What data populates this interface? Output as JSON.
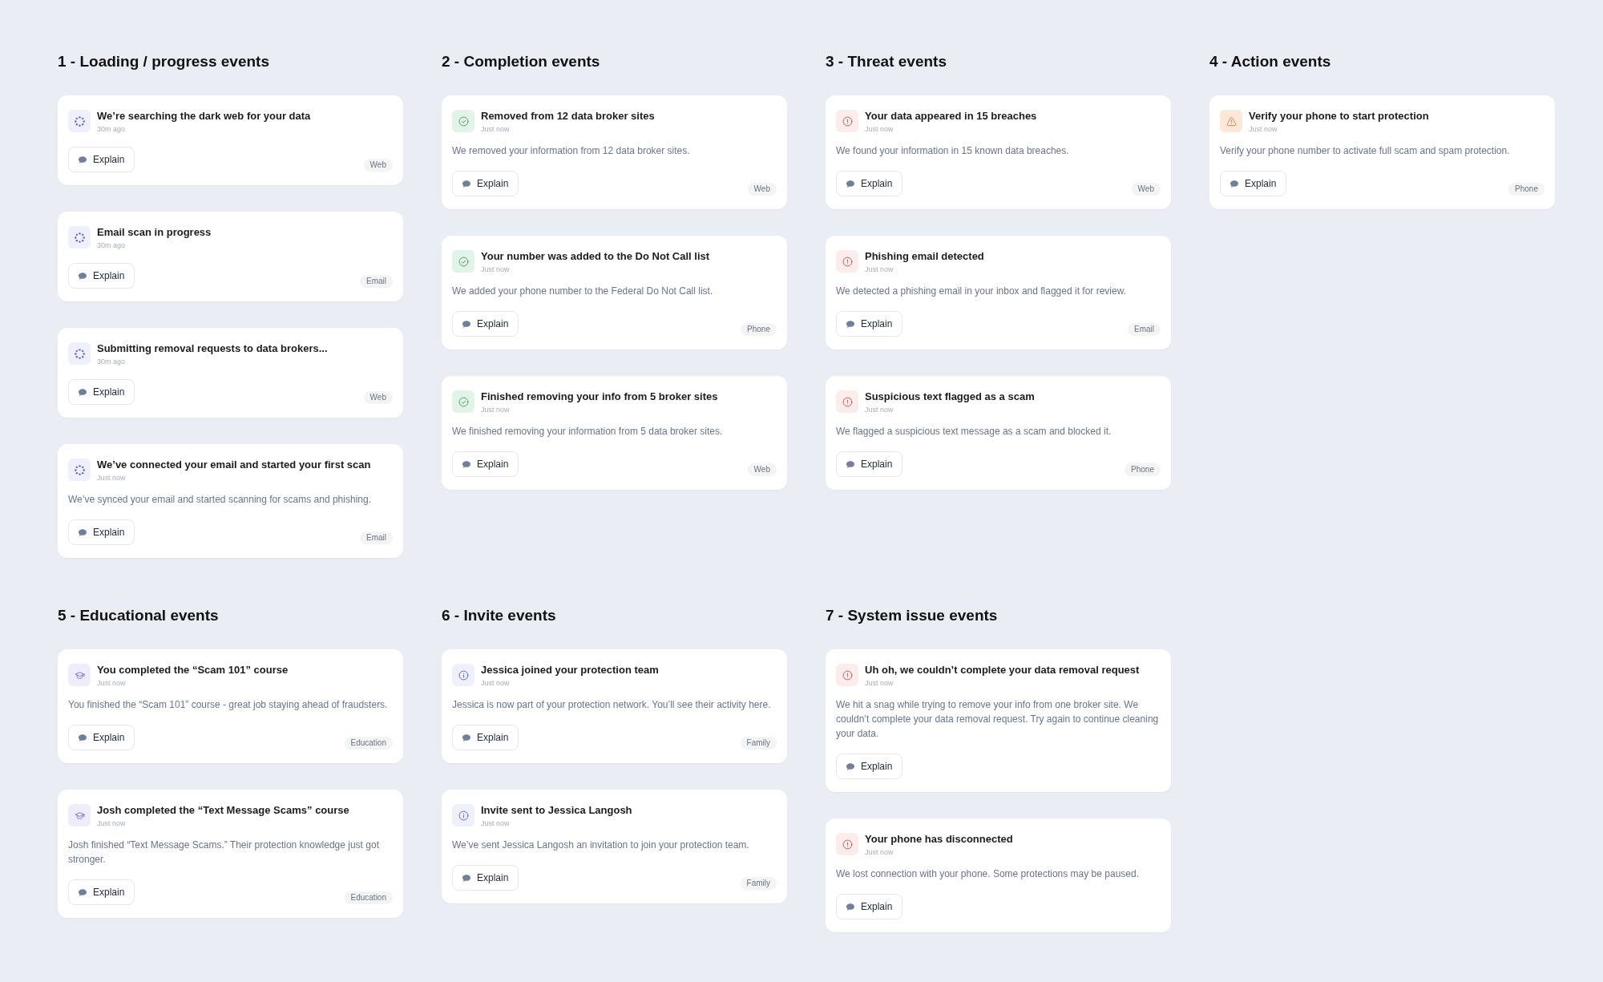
{
  "sections": [
    {
      "title": "1 - Loading / progress events",
      "kind": "loading",
      "events": [
        {
          "title": "We’re searching the dark web for your data",
          "time": "30m ago",
          "button": "Explain",
          "tag": "Web"
        },
        {
          "title": "Email scan in progress",
          "time": "30m ago",
          "button": "Explain",
          "tag": "Email"
        },
        {
          "title": "Submitting removal requests to data brokers...",
          "time": "30m ago",
          "button": "Explain",
          "tag": "Web"
        },
        {
          "title": "We’ve connected your email and started your first scan",
          "time": "Just now",
          "description": "We’ve synced your email and started scanning for scams and phishing.",
          "button": "Explain",
          "tag": "Email"
        }
      ]
    },
    {
      "title": "2 - Completion events",
      "kind": "success",
      "events": [
        {
          "title": "Removed from 12 data broker sites",
          "time": "Just now",
          "description": "We removed your information from 12 data broker sites.",
          "button": "Explain",
          "tag": "Web"
        },
        {
          "title": "Your number was added to the Do Not Call list",
          "time": "Just now",
          "description": "We added your phone number to the Federal Do Not Call list.",
          "button": "Explain",
          "tag": "Phone"
        },
        {
          "title": "Finished removing your info from 5 broker sites",
          "time": "Just now",
          "description": "We finished removing your information from 5 data broker sites.",
          "button": "Explain",
          "tag": "Web"
        }
      ]
    },
    {
      "title": "3 - Threat events",
      "kind": "alert",
      "events": [
        {
          "title": "Your data appeared in 15 breaches",
          "time": "Just now",
          "description": "We found your information in 15 known data breaches.",
          "button": "Explain",
          "tag": "Web"
        },
        {
          "title": "Phishing email detected",
          "time": "Just now",
          "description": "We detected a phishing email in your inbox and flagged it for review.",
          "button": "Explain",
          "tag": "Email"
        },
        {
          "title": "Suspicious text flagged as a scam",
          "time": "Just now",
          "description": "We flagged a suspicious text message as a scam and blocked it.",
          "button": "Explain",
          "tag": "Phone"
        }
      ]
    },
    {
      "title": "4 - Action events",
      "kind": "action",
      "events": [
        {
          "title": "Verify your phone to start protection",
          "time": "Just now",
          "description": "Verify your phone number to activate full scam and spam protection.",
          "button": "Explain",
          "tag": "Phone"
        }
      ]
    },
    {
      "title": "5 - Educational events",
      "kind": "education",
      "events": [
        {
          "title": "You completed the “Scam 101” course",
          "time": "Just now",
          "description": "You finished the “Scam 101” course - great job staying ahead of fraudsters.",
          "button": "Explain",
          "tag": "Education"
        },
        {
          "title": "Josh completed the “Text Message Scams” course",
          "time": "Just now",
          "description": "Josh finished “Text Message Scams.” Their protection knowledge just got stronger.",
          "button": "Explain",
          "tag": "Education"
        }
      ]
    },
    {
      "title": "6 - Invite events",
      "kind": "info",
      "events": [
        {
          "title": "Jessica joined your protection team",
          "time": "Just now",
          "description": "Jessica is now part of your protection network. You’ll see their activity here.",
          "button": "Explain",
          "tag": "Family"
        },
        {
          "title": "Invite sent to Jessica Langosh",
          "time": "Just now",
          "description": "We’ve sent Jessica Langosh an invitation to join your protection team.",
          "button": "Explain",
          "tag": "Family"
        }
      ]
    },
    {
      "title": "7 - System issue events",
      "kind": "alert",
      "events": [
        {
          "title": "Uh oh, we couldn’t complete your data removal request",
          "time": "Just now",
          "description": "We hit a snag while trying to remove your info from one broker site. We couldn’t complete your data removal request. Try again to continue cleaning your data.",
          "button": "Explain"
        },
        {
          "title": "Your phone has disconnected",
          "time": "Just now",
          "description": "We lost connection with your phone. Some protections may be paused.",
          "button": "Explain"
        }
      ]
    }
  ]
}
